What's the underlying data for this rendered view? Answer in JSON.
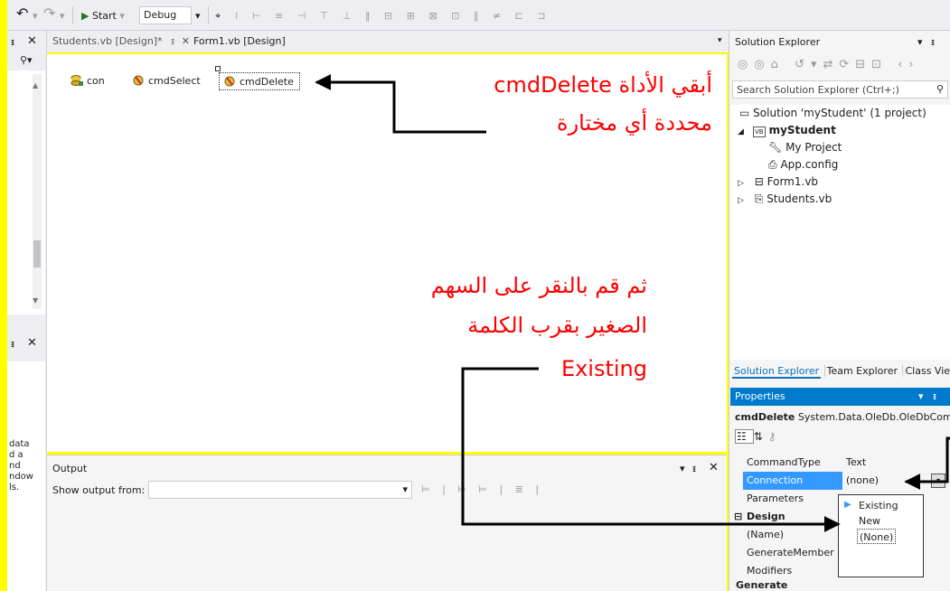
{
  "toolbar": {
    "start_label": "Start",
    "config_value": "Debug"
  },
  "left_panel": {
    "pin_icon": "pin-icon",
    "close_icon": "close-icon",
    "text_lines": [
      "data",
      "d a",
      "nd",
      "ndow",
      "ls."
    ]
  },
  "doc_tabs": [
    {
      "label": "Students.vb [Design]*",
      "active": false
    },
    {
      "label": "Form1.vb [Design]",
      "active": true
    }
  ],
  "designer": {
    "components": [
      {
        "label": "con",
        "icon": "connection-icon"
      },
      {
        "label": "cmdSelect",
        "icon": "command-icon"
      },
      {
        "label": "cmdDelete",
        "icon": "command-icon",
        "selected": true
      }
    ]
  },
  "output": {
    "title": "Output",
    "show_from_label": "Show output from:"
  },
  "solution_explorer": {
    "title": "Solution Explorer",
    "search_placeholder": "Search Solution Explorer (Ctrl+;)",
    "tree": [
      {
        "label": "Solution 'myStudent' (1 project)",
        "level": 0,
        "icon": "solution-icon"
      },
      {
        "label": "myStudent",
        "level": 1,
        "icon": "vb-project-icon",
        "bold": true,
        "expanded": true
      },
      {
        "label": "My Project",
        "level": 2,
        "icon": "wrench-icon"
      },
      {
        "label": "App.config",
        "level": 2,
        "icon": "config-icon"
      },
      {
        "label": "Form1.vb",
        "level": 2,
        "icon": "form-icon",
        "collapsed": true
      },
      {
        "label": "Students.vb",
        "level": 2,
        "icon": "component-icon",
        "collapsed": true
      }
    ],
    "bottom_tabs": [
      "Solution Explorer",
      "Team Explorer",
      "Class View"
    ]
  },
  "properties": {
    "title": "Properties",
    "object_name": "cmdDelete",
    "object_type": "System.Data.OleDb.OleDbComm",
    "rows": [
      {
        "name": "CommandType",
        "value": "Text"
      },
      {
        "name": "Connection",
        "value": "(none)",
        "selected": true
      },
      {
        "name": "Parameters",
        "value": ""
      }
    ],
    "category": "Design",
    "design_rows": [
      "(Name)",
      "GenerateMember",
      "Modifiers"
    ],
    "bottom_category": "Generate"
  },
  "dropdown": {
    "items": [
      "Existing",
      "New",
      "(None)"
    ]
  },
  "annotations": {
    "top_line1": "أبقي الأداة cmdDelete",
    "top_line2": "محددة أي مختارة",
    "mid_line1": "ثم قم بالنقر على السهم",
    "mid_line2": "الصغير بقرب الكلمة",
    "mid_line3": "Existing",
    "color": "#ff0000"
  }
}
